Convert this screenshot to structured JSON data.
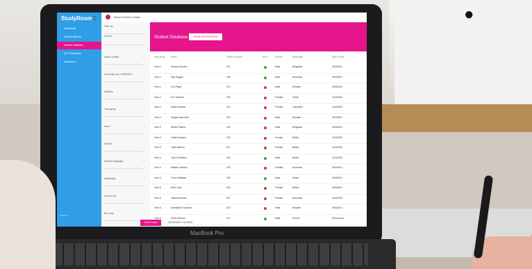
{
  "laptop": {
    "label": "MacBook Pro"
  },
  "app": {
    "logo": "StudyRoom",
    "school_name": "Demo School London",
    "sidebar": {
      "items": [
        "Dashboard",
        "Activity calendar",
        "Student Database",
        "ALFP Database",
        "Attendance"
      ],
      "active_index": 2,
      "footer": "SCHOOL"
    },
    "filters": {
      "search_label": "Filter by",
      "search_placeholder": "Search",
      "items": [
        "Status: Active",
        "Currently Live: 20/05/2021",
        "Stations",
        "Year group",
        "New?",
        "Gender",
        "Student language",
        "Nationality",
        "School bus",
        "Bus stop"
      ]
    },
    "header": {
      "title": "Student Database",
      "button": "SEND NOTIFICATION"
    },
    "columns": [
      "Year group",
      "Name",
      "Student number",
      "New?",
      "Gender",
      "Nationality",
      "Date of birth"
    ],
    "rows": [
      {
        "year": "Year 1",
        "name": "Rowan Bowden",
        "num": "201",
        "new": "green",
        "gender": "Male",
        "nat": "Bulgarian",
        "dob": "25/4/2001"
      },
      {
        "year": "Year 1",
        "name": "Ray Noggin",
        "num": "208",
        "new": "green",
        "gender": "Male",
        "nat": "American",
        "dob": "25/4/2001"
      },
      {
        "year": "Year 1",
        "name": "Len Pigott",
        "num": "214",
        "new": "red",
        "gender": "Male",
        "nat": "Russian",
        "dob": "25/4/2001"
      },
      {
        "year": "Year 2",
        "name": "Eve Hannah",
        "num": "206",
        "new": "red",
        "gender": "Female",
        "nat": "Greek",
        "dob": "14/4/2000"
      },
      {
        "year": "Year 2",
        "name": "Mollie Stewart",
        "num": "213",
        "new": "red",
        "gender": "Female",
        "nat": "Canadian",
        "dob": "14/4/2000"
      },
      {
        "year": "Year 2",
        "name": "Sergey Ivanovich",
        "num": "210",
        "new": "red",
        "gender": "Male",
        "nat": "Russian",
        "dob": "25/4/2001"
      },
      {
        "year": "Year 3",
        "name": "Stefan Filanov",
        "num": "203",
        "new": "red",
        "gender": "Male",
        "nat": "Bulgarian",
        "dob": "25/4/2001"
      },
      {
        "year": "Year 3",
        "name": "Joelle Kamara",
        "num": "204",
        "new": "red",
        "gender": "Female",
        "nat": "British",
        "dob": "14/4/2000"
      },
      {
        "year": "Year 3",
        "name": "Jude Watson",
        "num": "211",
        "new": "red",
        "gender": "Female",
        "nat": "British",
        "dob": "14/4/2000"
      },
      {
        "year": "Year 4",
        "name": "John Dickinson",
        "num": "209",
        "new": "green",
        "gender": "Male",
        "nat": "British",
        "dob": "14/4/2000"
      },
      {
        "year": "Year 4",
        "name": "Natalie Jackson",
        "num": "200",
        "new": "red",
        "gender": "Female",
        "nat": "American",
        "dob": "25/4/2001"
      },
      {
        "year": "Year 4",
        "name": "Theo Kirlikakis",
        "num": "205",
        "new": "green",
        "gender": "Male",
        "nat": "Greek",
        "dob": "25/4/2001"
      },
      {
        "year": "Year 5",
        "name": "Ruth Lake",
        "num": "215",
        "new": "red",
        "gender": "Female",
        "nat": "British",
        "dob": "25/4/2001"
      },
      {
        "year": "Year 5",
        "name": "Jessica Brooks",
        "num": "207",
        "new": "red",
        "gender": "Female",
        "nat": "American",
        "dob": "14/4/2000"
      },
      {
        "year": "Year 5",
        "name": "Konstantin Fyodorov",
        "num": "216",
        "new": "red",
        "gender": "Male",
        "nat": "Russian",
        "dob": "25/4/2001"
      },
      {
        "year": "Year 6",
        "name": "Pierre Dubois",
        "num": "212",
        "new": "green",
        "gender": "Male",
        "nat": "French",
        "dob": "Show more"
      }
    ],
    "actions": {
      "primary": "Send Emails",
      "secondary": "SHOW/HIDE COLUMNS"
    }
  },
  "colors": {
    "sidebar": "#2f9ee7",
    "accent": "#e5168c",
    "new_yes": "#3aa83a",
    "new_no": "#e0314b"
  }
}
